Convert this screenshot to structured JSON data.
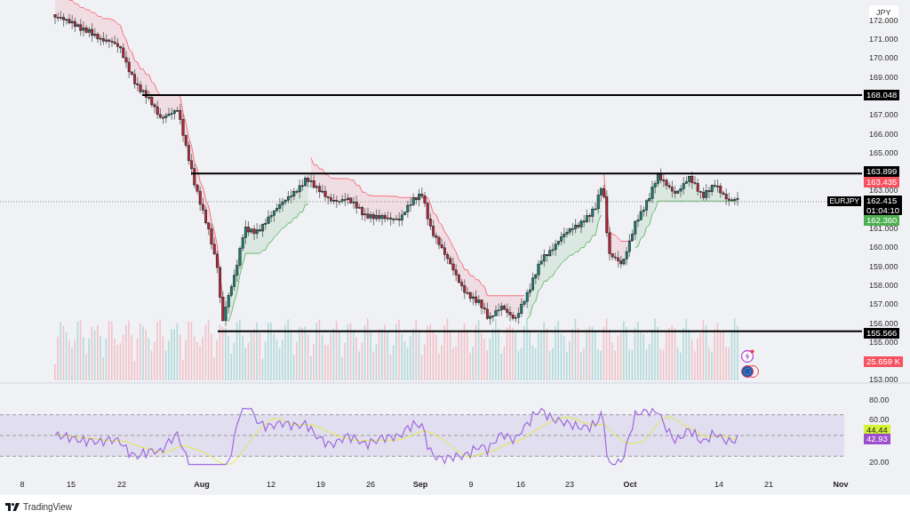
{
  "price_axis": {
    "currency": "JPY",
    "ticks": [
      "172.000",
      "171.000",
      "170.000",
      "169.000",
      "167.000",
      "166.000",
      "165.000",
      "163.000",
      "161.000",
      "160.000",
      "159.000",
      "158.000",
      "157.000",
      "156.000",
      "155.000",
      "153.000"
    ]
  },
  "price_badges": [
    {
      "kind": "level",
      "value": "168.048",
      "color": "#000000"
    },
    {
      "kind": "level",
      "value": "163.899",
      "color": "#000000"
    },
    {
      "kind": "plain",
      "value": "163.435",
      "color": "#f7525f"
    },
    {
      "kind": "last",
      "symbol": "EURJPY",
      "value": "162.415",
      "countdown": "01:04:10",
      "color": "#000000"
    },
    {
      "kind": "plain",
      "value": "162.360",
      "color": "#4caf50"
    },
    {
      "kind": "level",
      "value": "155.566",
      "color": "#000000"
    },
    {
      "kind": "plain",
      "value": "25.659 K",
      "color": "#f7525f"
    }
  ],
  "rsi_axis": {
    "ticks": [
      "80.00",
      "60.00",
      "20.00"
    ],
    "badges": [
      {
        "value": "44.44",
        "color": "#d4f236"
      },
      {
        "value": "42.93",
        "color": "#9c4dcc"
      }
    ]
  },
  "time_axis": [
    {
      "text": "8",
      "kind": "day"
    },
    {
      "text": "15",
      "kind": "day"
    },
    {
      "text": "22",
      "kind": "day"
    },
    {
      "text": "Aug",
      "kind": "month"
    },
    {
      "text": "12",
      "kind": "day"
    },
    {
      "text": "19",
      "kind": "day"
    },
    {
      "text": "26",
      "kind": "day"
    },
    {
      "text": "Sep",
      "kind": "month"
    },
    {
      "text": "9",
      "kind": "day"
    },
    {
      "text": "16",
      "kind": "day"
    },
    {
      "text": "23",
      "kind": "day"
    },
    {
      "text": "Oct",
      "kind": "month"
    },
    {
      "text": "14",
      "kind": "day"
    },
    {
      "text": "21",
      "kind": "day"
    },
    {
      "text": "Nov",
      "kind": "month"
    }
  ],
  "footer": {
    "brand": "TradingView"
  }
}
